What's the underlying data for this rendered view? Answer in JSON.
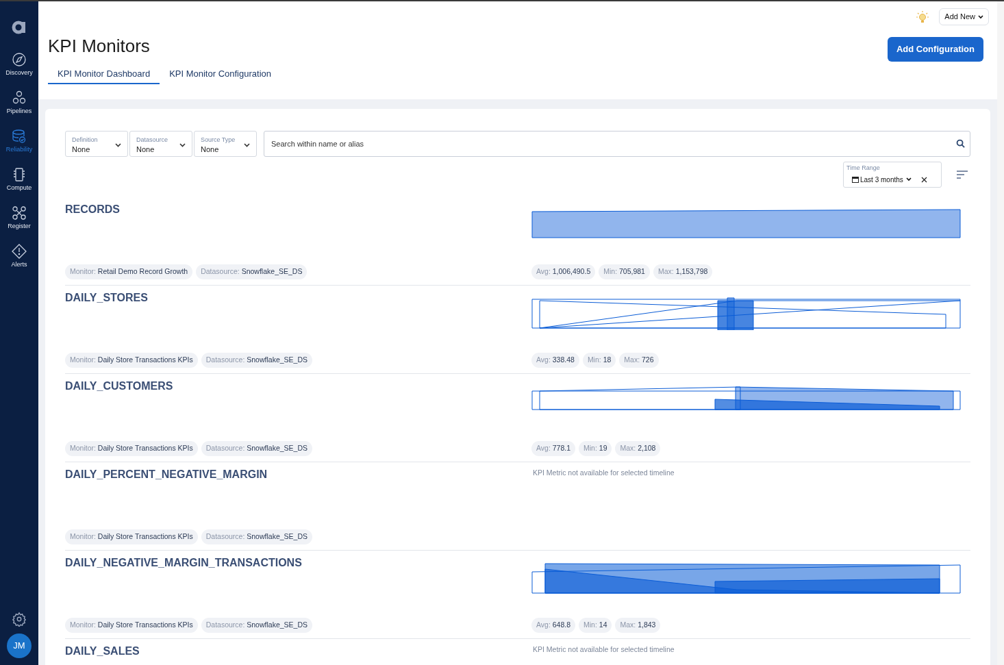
{
  "sidebar": {
    "items": [
      {
        "label": "Discovery",
        "selected": false
      },
      {
        "label": "Pipelines",
        "selected": false
      },
      {
        "label": "Reliability",
        "selected": true
      },
      {
        "label": "Compute",
        "selected": false
      },
      {
        "label": "Register",
        "selected": false
      },
      {
        "label": "Alerts",
        "selected": false
      }
    ],
    "avatar": "JM"
  },
  "header": {
    "title": "KPI Monitors",
    "add_new": "Add New",
    "primary_button": "Add Configuration"
  },
  "tabs": [
    {
      "label": "KPI Monitor Dashboard",
      "selected": true
    },
    {
      "label": "KPI Monitor Configuration",
      "selected": false
    }
  ],
  "filters": [
    {
      "label": "Definition",
      "value": "None"
    },
    {
      "label": "Datasource",
      "value": "None"
    },
    {
      "label": "Source Type",
      "value": "None"
    }
  ],
  "search": {
    "placeholder": "Search within name or alias"
  },
  "time_range": {
    "label": "Time Range",
    "value": "Last 3 months"
  },
  "monitors": [
    {
      "name": "RECORDS",
      "kind": "chart",
      "monitor_label": "Monitor:",
      "monitor": "Retail Demo Record Growth",
      "datasource_label": "Datasource:",
      "datasource": "Snowflake_SE_DS",
      "stats": [
        {
          "label": "Avg:",
          "value": "1,006,490.5"
        },
        {
          "label": "Min:",
          "value": "705,981"
        },
        {
          "label": "Max:",
          "value": "1,153,798"
        }
      ]
    },
    {
      "name": "DAILY_STORES",
      "kind": "chart",
      "monitor_label": "Monitor:",
      "monitor": "Daily Store Transactions KPIs",
      "datasource_label": "Datasource:",
      "datasource": "Snowflake_SE_DS",
      "stats": [
        {
          "label": "Avg:",
          "value": "338.48"
        },
        {
          "label": "Min:",
          "value": "18"
        },
        {
          "label": "Max:",
          "value": "726"
        }
      ]
    },
    {
      "name": "DAILY_CUSTOMERS",
      "kind": "chart",
      "monitor_label": "Monitor:",
      "monitor": "Daily Store Transactions KPIs",
      "datasource_label": "Datasource:",
      "datasource": "Snowflake_SE_DS",
      "stats": [
        {
          "label": "Avg:",
          "value": "778.1"
        },
        {
          "label": "Min:",
          "value": "19"
        },
        {
          "label": "Max:",
          "value": "2,108"
        }
      ]
    },
    {
      "name": "DAILY_PERCENT_NEGATIVE_MARGIN",
      "kind": "unavailable",
      "message": "KPI Metric not available for selected timeline",
      "monitor_label": "Monitor:",
      "monitor": "Daily Store Transactions KPIs",
      "datasource_label": "Datasource:",
      "datasource": "Snowflake_SE_DS"
    },
    {
      "name": "DAILY_NEGATIVE_MARGIN_TRANSACTIONS",
      "kind": "chart",
      "monitor_label": "Monitor:",
      "monitor": "Daily Store Transactions KPIs",
      "datasource_label": "Datasource:",
      "datasource": "Snowflake_SE_DS",
      "stats": [
        {
          "label": "Avg:",
          "value": "648.8"
        },
        {
          "label": "Min:",
          "value": "14"
        },
        {
          "label": "Max:",
          "value": "1,843"
        }
      ]
    },
    {
      "name": "DAILY_SALES",
      "kind": "unavailable",
      "message": "KPI Metric not available for selected timeline"
    }
  ]
}
